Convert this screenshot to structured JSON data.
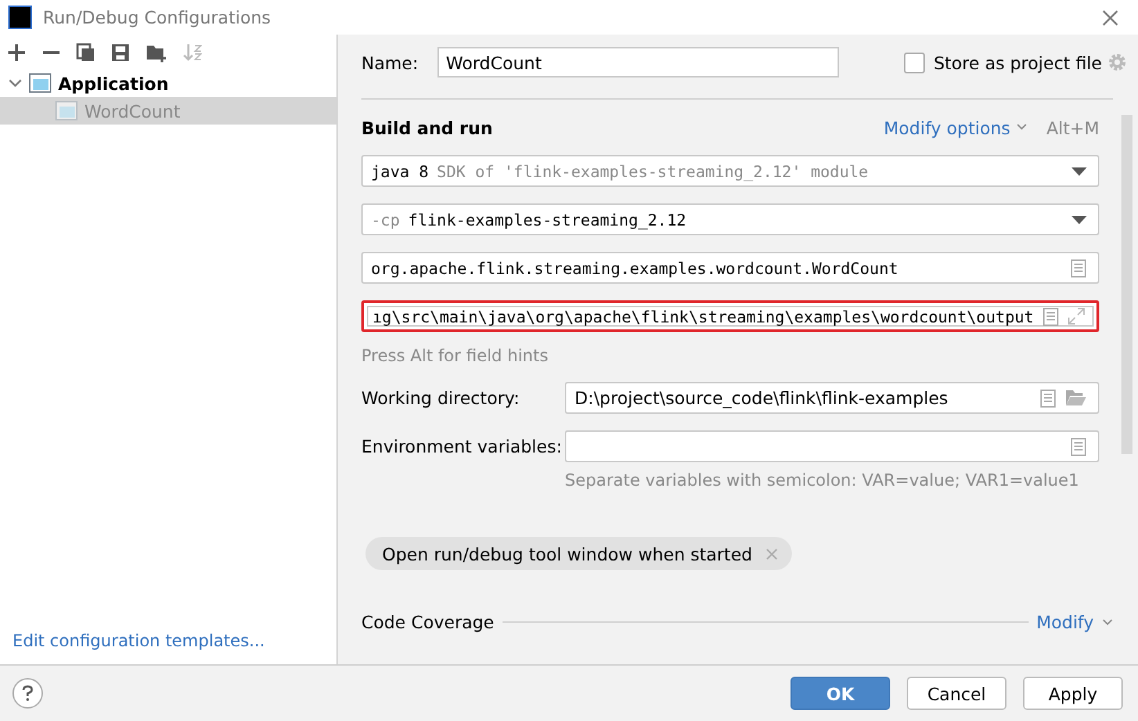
{
  "window": {
    "title": "Run/Debug Configurations"
  },
  "sidebar": {
    "items": [
      {
        "label": "Application",
        "expanded": true,
        "selected": false,
        "children": [
          {
            "label": "WordCount",
            "selected": true
          }
        ]
      }
    ],
    "footer_link": "Edit configuration templates..."
  },
  "name_field": {
    "label": "Name:",
    "value": "WordCount"
  },
  "store_as_project_file": {
    "label": "Store as project file",
    "checked": false
  },
  "build_and_run": {
    "title": "Build and run",
    "modify_options": "Modify options",
    "shortcut": "Alt+M",
    "rows": [
      {
        "kind": "dropdown",
        "value": "java 8",
        "hint": "SDK of 'flink-examples-streaming_2.12' module"
      },
      {
        "kind": "dropdown",
        "prefix": "-cp",
        "value": "flink-examples-streaming_2.12"
      },
      {
        "kind": "field",
        "value": "org.apache.flink.streaming.examples.wordcount.WordCount",
        "highlighted": false,
        "expandable": false
      },
      {
        "kind": "field",
        "value": "ıg\\src\\main\\java\\org\\apache\\flink\\streaming\\examples\\wordcount\\output",
        "highlighted": true,
        "expandable": true
      }
    ],
    "hint": "Press Alt for field hints"
  },
  "working_directory": {
    "label": "Working directory:",
    "value": "D:\\project\\source_code\\flink\\flink-examples"
  },
  "environment_variables": {
    "label": "Environment variables:",
    "hint": "Separate variables with semicolon: VAR=value; VAR1=value1"
  },
  "option_chip": {
    "label": "Open run/debug tool window when started"
  },
  "code_coverage": {
    "title": "Code Coverage",
    "modify": "Modify"
  },
  "buttons": [
    {
      "label": "OK",
      "kind": "primary"
    },
    {
      "label": "Cancel",
      "kind": "normal"
    },
    {
      "label": "Apply",
      "kind": "normal"
    }
  ]
}
